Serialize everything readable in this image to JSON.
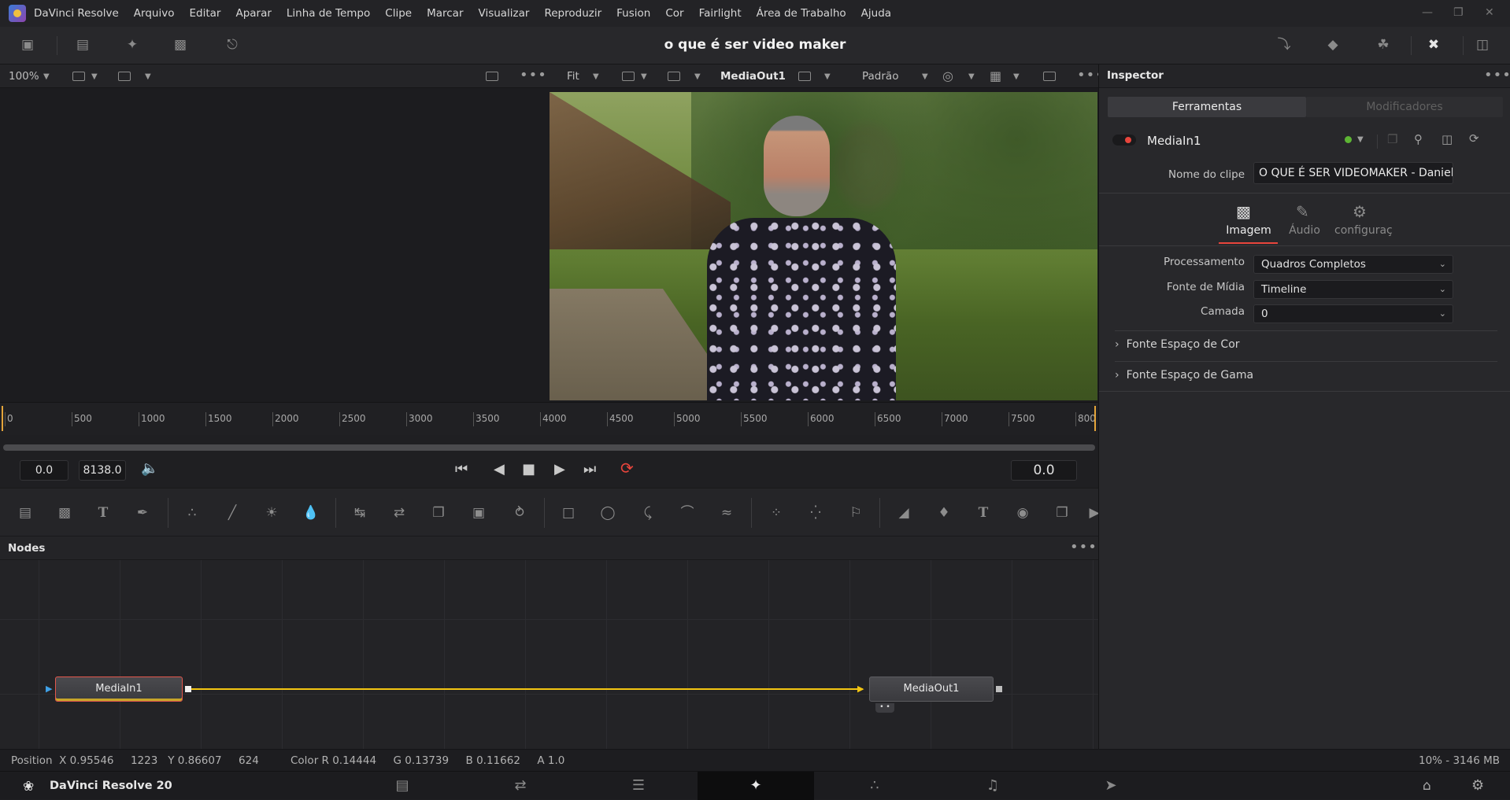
{
  "app": {
    "name": "DaVinci Resolve",
    "menu": [
      "Arquivo",
      "Editar",
      "Aparar",
      "Linha de Tempo",
      "Clipe",
      "Marcar",
      "Visualizar",
      "Reproduzir",
      "Fusion",
      "Cor",
      "Fairlight",
      "Área de Trabalho",
      "Ajuda"
    ]
  },
  "toolbar": {
    "project_title": "o que é ser video maker"
  },
  "viewer_left": {
    "zoom": "100%"
  },
  "viewer_right": {
    "fit": "Fit",
    "node_name": "MediaOut1",
    "view_mode": "Padrão"
  },
  "timeline": {
    "ticks": [
      "0",
      "500",
      "1000",
      "1500",
      "2000",
      "2500",
      "3000",
      "3500",
      "4000",
      "4500",
      "5000",
      "5500",
      "6000",
      "6500",
      "7000",
      "7500",
      "800"
    ],
    "start_field": "0.0",
    "end_field": "8138.0",
    "current_time": "0.0"
  },
  "nodes": {
    "title": "Nodes",
    "media_in": "MediaIn1",
    "media_out": "MediaOut1",
    "link_color": "#f3c512"
  },
  "status": {
    "position": "Position  X 0.95546     1223   Y 0.86607     624",
    "color": "Color R 0.14444     G 0.13739     B 0.11662     A 1.0",
    "memory": "10% - 3146 MB"
  },
  "page_bar": {
    "product": "DaVinci Resolve 20"
  },
  "inspector": {
    "title": "Inspector",
    "tabs": [
      "Ferramentas",
      "Modificadores"
    ],
    "node_name": "MediaIn1",
    "clip_name_label": "Nome do clipe",
    "clip_name_value": "O QUE É SER VIDEOMAKER - Daniel",
    "sub_tabs": [
      "Imagem",
      "Áudio",
      "configuraçõe"
    ],
    "rows": [
      {
        "label": "Processamento",
        "value": "Quadros Completos"
      },
      {
        "label": "Fonte de Mídia",
        "value": "Timeline"
      },
      {
        "label": "Camada",
        "value": "0"
      }
    ],
    "sections": [
      "Fonte Espaço de Cor",
      "Fonte Espaço de Gama"
    ],
    "accent_color": "#e8453c"
  }
}
